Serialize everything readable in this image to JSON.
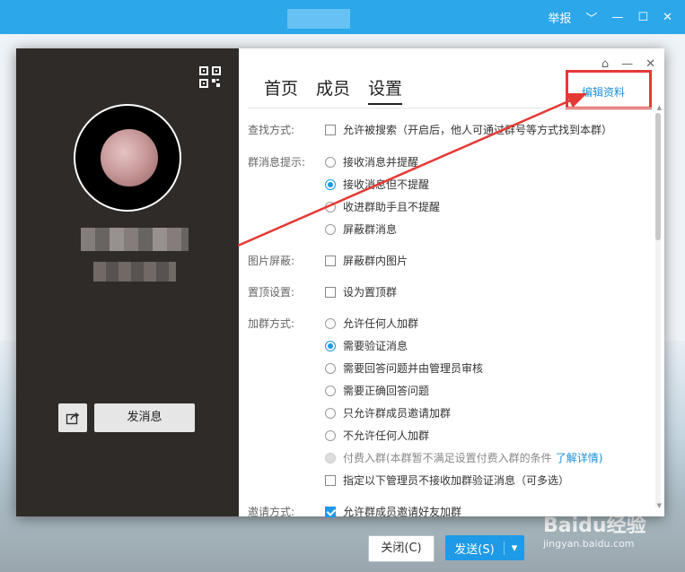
{
  "background": {
    "report_label": "举报",
    "close_button_label": "关闭(C)",
    "send_button_label": "发送(S)",
    "watermark_brand": "Baidu经验",
    "watermark_url": "jingyan.baidu.com"
  },
  "dialog": {
    "share_icon": "share-icon",
    "send_message_label": "发消息",
    "tabs": [
      "首页",
      "成员",
      "设置"
    ],
    "active_tab": "设置",
    "edit_profile_label": "编辑资料",
    "settings": {
      "search": {
        "label": "查找方式:",
        "option": "允许被搜索（开启后，他人可通过群号等方式找到本群）"
      },
      "notify": {
        "label": "群消息提示:",
        "options": [
          "接收消息并提醒",
          "接收消息但不提醒",
          "收进群助手且不提醒",
          "屏蔽群消息"
        ],
        "selected_index": 1
      },
      "image_block": {
        "label": "图片屏蔽:",
        "option": "屏蔽群内图片"
      },
      "pin": {
        "label": "置顶设置:",
        "option": "设为置顶群"
      },
      "join": {
        "label": "加群方式:",
        "options": [
          "允许任何人加群",
          "需要验证消息",
          "需要回答问题并由管理员审核",
          "需要正确回答问题",
          "只允许群成员邀请加群",
          "不允许任何人加群"
        ],
        "selected_index": 1,
        "paid_option": "付费入群(本群暂不满足设置付费入群的条件",
        "paid_link": "了解详情)",
        "admin_option": "指定以下管理员不接收加群验证消息（可多选）"
      },
      "invite": {
        "label": "邀请方式:",
        "option": "允许群成员邀请好友加群",
        "checked": true
      }
    }
  },
  "colors": {
    "accent": "#1e9ae6",
    "highlight": "#e53935",
    "panel": "#2f2b29"
  }
}
